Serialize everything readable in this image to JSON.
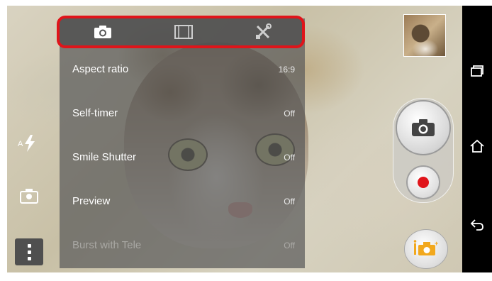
{
  "settings_tabs": [
    {
      "icon": "camera-icon",
      "active": true
    },
    {
      "icon": "video-frame-icon",
      "active": false
    },
    {
      "icon": "tools-icon",
      "active": false
    }
  ],
  "settings": [
    {
      "label": "Aspect ratio",
      "value": "16:9",
      "dim": false
    },
    {
      "label": "Self-timer",
      "value": "Off",
      "dim": false
    },
    {
      "label": "Smile Shutter",
      "value": "Off",
      "dim": false
    },
    {
      "label": "Preview",
      "value": "Off",
      "dim": false
    },
    {
      "label": "Burst with Tele",
      "value": "Off",
      "dim": true
    }
  ],
  "left_controls": [
    "flash-auto-icon",
    "scene-portrait-icon",
    "menu-icon"
  ],
  "right_controls": [
    "gallery-thumbnail",
    "shutter-camera-icon",
    "record-video-icon",
    "superior-auto-mode-icon"
  ],
  "nav_buttons": [
    "recent-apps-icon",
    "home-icon",
    "back-icon"
  ],
  "colors": {
    "highlight": "#e0141a",
    "record": "#e0141a",
    "mode_icon": "#f2a81d"
  }
}
